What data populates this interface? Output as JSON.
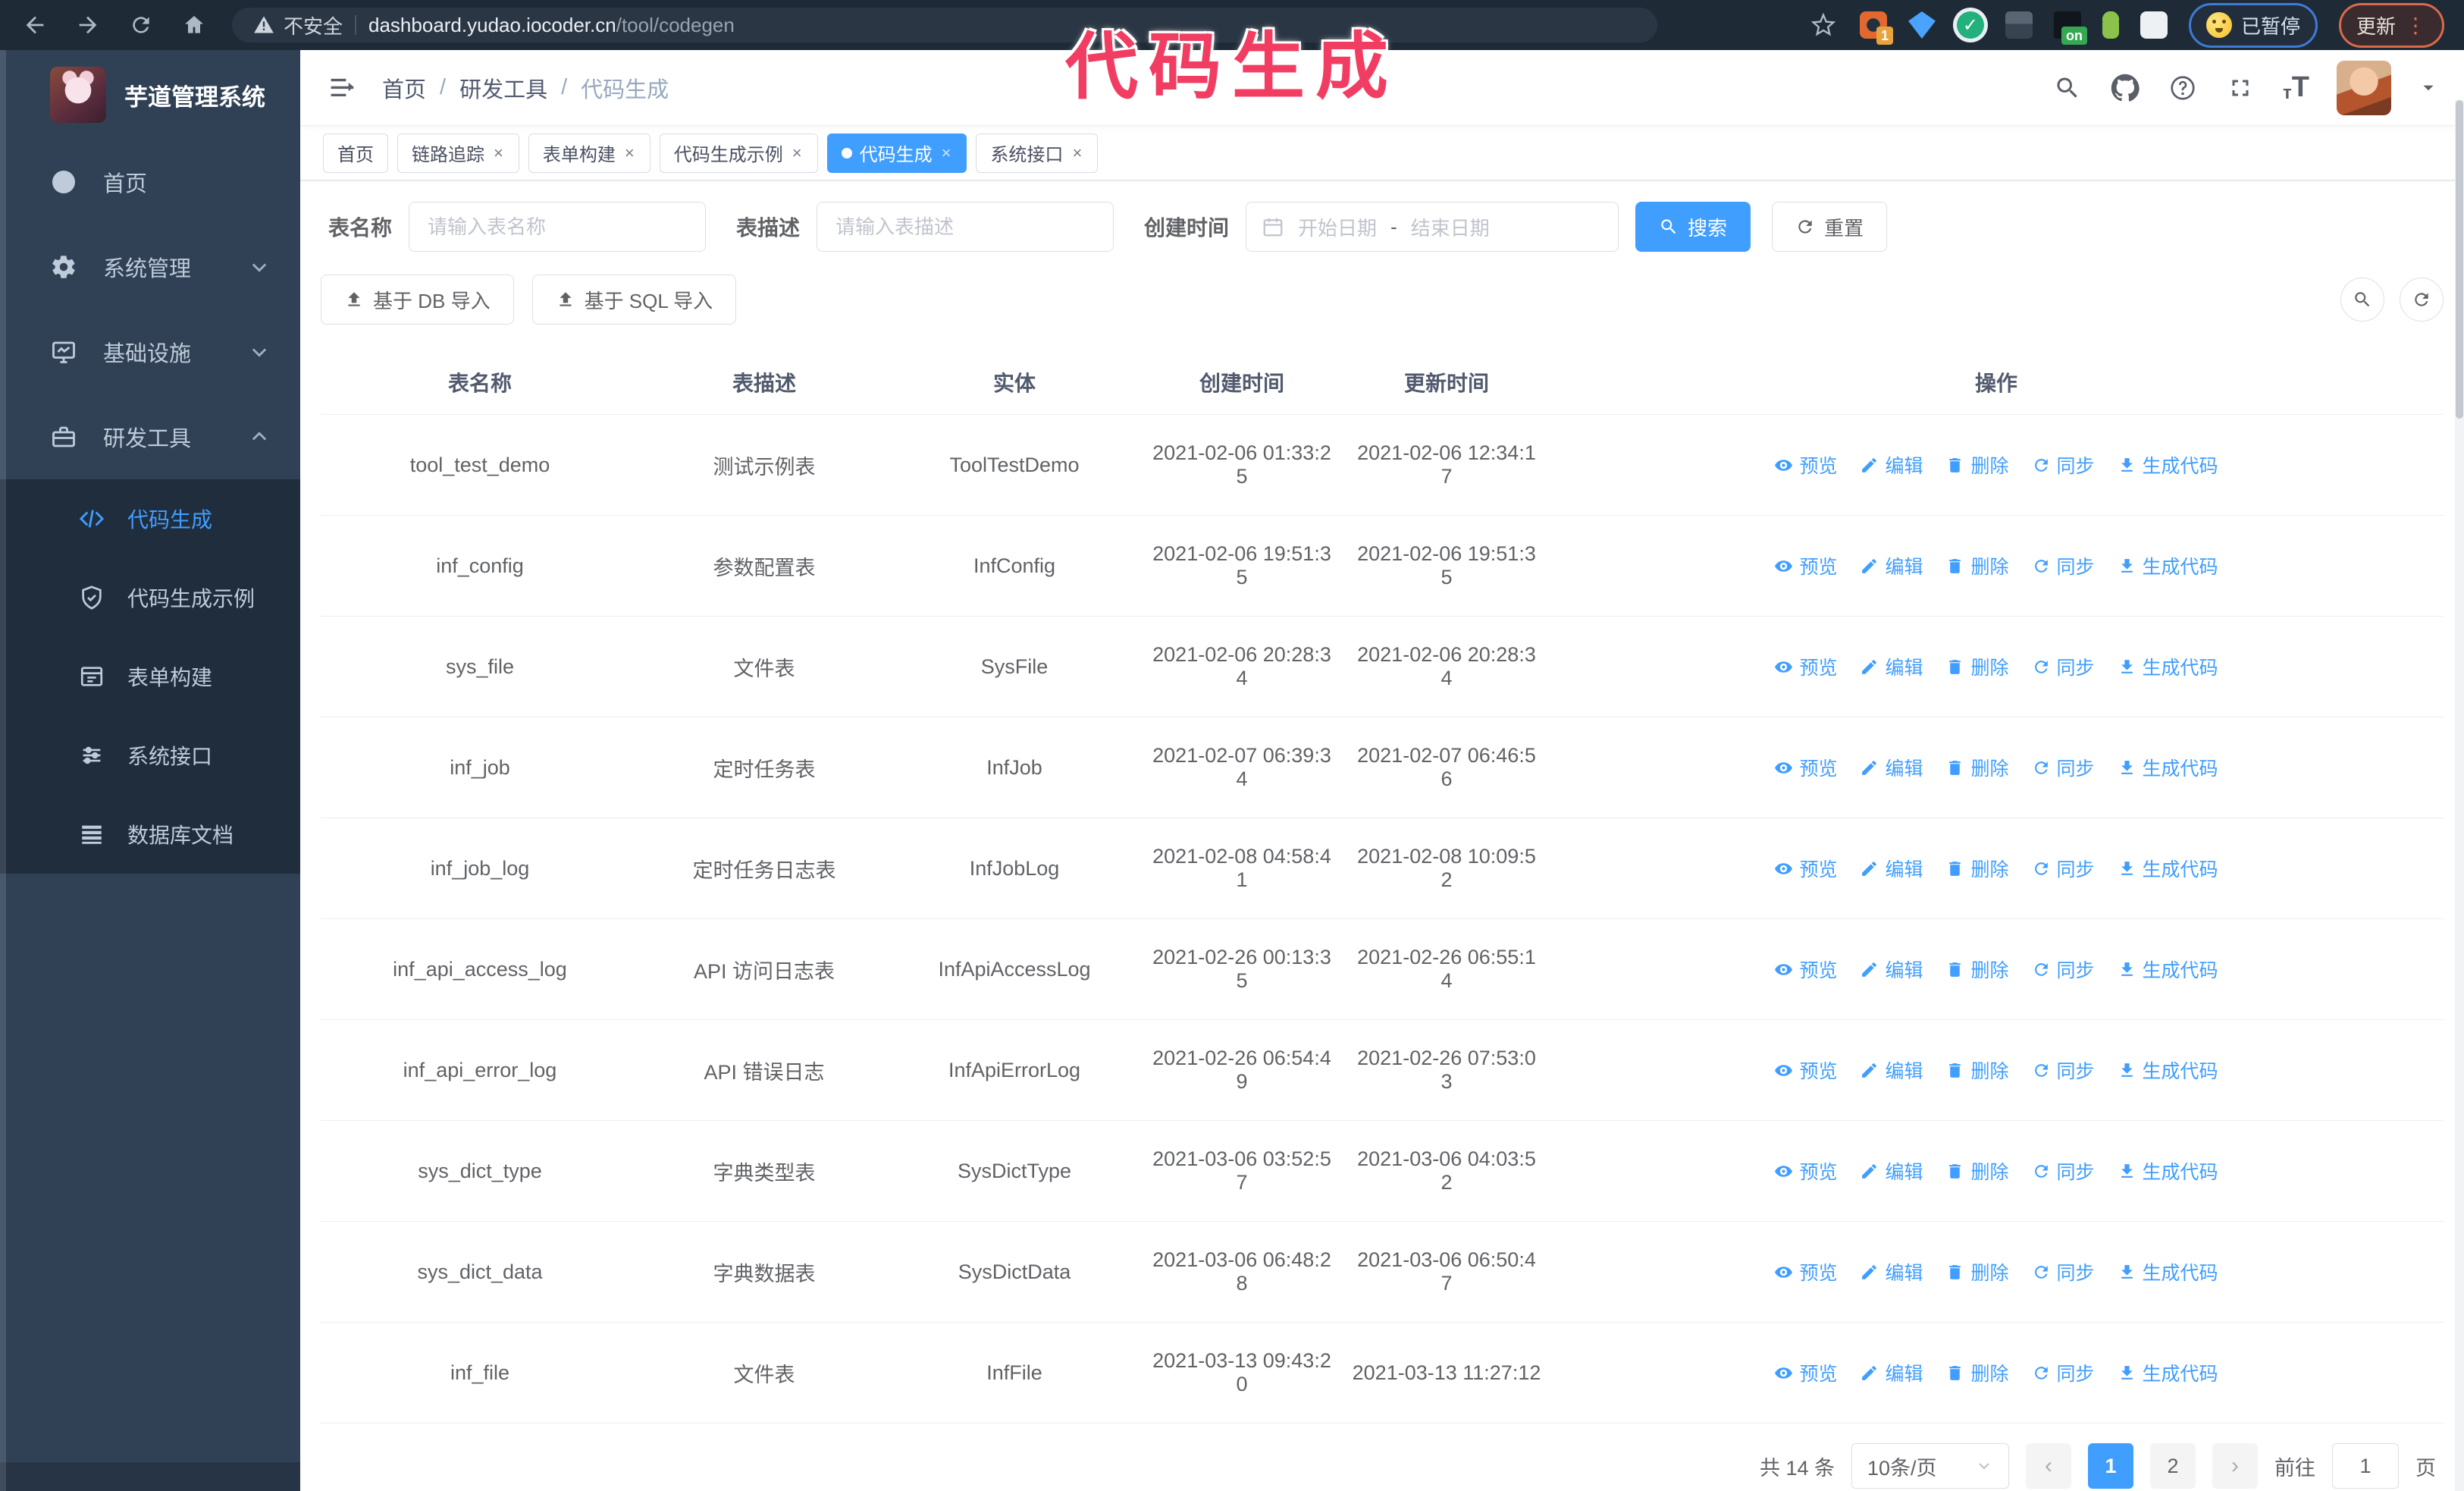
{
  "annotation": {
    "text": "代码生成",
    "color": "#f23d63"
  },
  "browser": {
    "security_warning": "不安全",
    "url_domain": "dashboard.yudao.iocoder.cn",
    "url_path": "/tool/codegen",
    "extension_badge_count": "1",
    "extension_badge_on": "on",
    "paused_badge": "已暂停",
    "update_badge": "更新",
    "menu_dots": "⋮"
  },
  "sidebar": {
    "logo_title": "芋道管理系统",
    "items": [
      {
        "label": "首页"
      },
      {
        "label": "系统管理"
      },
      {
        "label": "基础设施"
      },
      {
        "label": "研发工具"
      }
    ],
    "subitems": [
      {
        "label": "代码生成"
      },
      {
        "label": "代码生成示例"
      },
      {
        "label": "表单构建"
      },
      {
        "label": "系统接口"
      },
      {
        "label": "数据库文档"
      }
    ]
  },
  "breadcrumb": {
    "items": [
      "首页",
      "研发工具",
      "代码生成"
    ],
    "separator": "/"
  },
  "tabs": [
    {
      "label": "首页"
    },
    {
      "label": "链路追踪"
    },
    {
      "label": "表单构建"
    },
    {
      "label": "代码生成示例"
    },
    {
      "label": "代码生成"
    },
    {
      "label": "系统接口"
    }
  ],
  "tab_close_glyph": "×",
  "filters": {
    "table_name_label": "表名称",
    "table_name_placeholder": "请输入表名称",
    "table_desc_label": "表描述",
    "table_desc_placeholder": "请输入表描述",
    "create_time_label": "创建时间",
    "date_start_placeholder": "开始日期",
    "date_separator": "-",
    "date_end_placeholder": "结束日期",
    "search_button": "搜索",
    "reset_button": "重置"
  },
  "toolbar": {
    "import_db_button": "基于 DB 导入",
    "import_sql_button": "基于 SQL 导入"
  },
  "table": {
    "columns": [
      "表名称",
      "表描述",
      "实体",
      "创建时间",
      "更新时间",
      "操作"
    ],
    "action_labels": [
      "预览",
      "编辑",
      "删除",
      "同步",
      "生成代码"
    ],
    "rows": [
      {
        "name": "tool_test_demo",
        "desc": "测试示例表",
        "entity": "ToolTestDemo",
        "created": "2021-02-06 01:33:25",
        "updated": "2021-02-06 12:34:17"
      },
      {
        "name": "inf_config",
        "desc": "参数配置表",
        "entity": "InfConfig",
        "created": "2021-02-06 19:51:35",
        "updated": "2021-02-06 19:51:35"
      },
      {
        "name": "sys_file",
        "desc": "文件表",
        "entity": "SysFile",
        "created": "2021-02-06 20:28:34",
        "updated": "2021-02-06 20:28:34"
      },
      {
        "name": "inf_job",
        "desc": "定时任务表",
        "entity": "InfJob",
        "created": "2021-02-07 06:39:34",
        "updated": "2021-02-07 06:46:56"
      },
      {
        "name": "inf_job_log",
        "desc": "定时任务日志表",
        "entity": "InfJobLog",
        "created": "2021-02-08 04:58:41",
        "updated": "2021-02-08 10:09:52"
      },
      {
        "name": "inf_api_access_log",
        "desc": "API 访问日志表",
        "entity": "InfApiAccessLog",
        "created": "2021-02-26 00:13:35",
        "updated": "2021-02-26 06:55:14"
      },
      {
        "name": "inf_api_error_log",
        "desc": "API 错误日志",
        "entity": "InfApiErrorLog",
        "created": "2021-02-26 06:54:49",
        "updated": "2021-02-26 07:53:03"
      },
      {
        "name": "sys_dict_type",
        "desc": "字典类型表",
        "entity": "SysDictType",
        "created": "2021-03-06 03:52:57",
        "updated": "2021-03-06 04:03:52"
      },
      {
        "name": "sys_dict_data",
        "desc": "字典数据表",
        "entity": "SysDictData",
        "created": "2021-03-06 06:48:28",
        "updated": "2021-03-06 06:50:47"
      },
      {
        "name": "inf_file",
        "desc": "文件表",
        "entity": "InfFile",
        "created": "2021-03-13 09:43:20",
        "updated": "2021-03-13 11:27:12"
      }
    ]
  },
  "pagination": {
    "total_text": "共 14 条",
    "page_size": "10条/页",
    "prev_glyph": "‹",
    "next_glyph": "›",
    "pages": [
      "1",
      "2"
    ],
    "active_page": "1",
    "goto_label": "前往",
    "goto_value": "1",
    "goto_suffix": "页"
  },
  "colors": {
    "accent_blue": "#409eff",
    "sidebar_bg": "#304156",
    "submenu_bg": "#1f2d3d",
    "browser_bar_bg": "#1e2a36",
    "annotation_pink": "#f23d63"
  }
}
